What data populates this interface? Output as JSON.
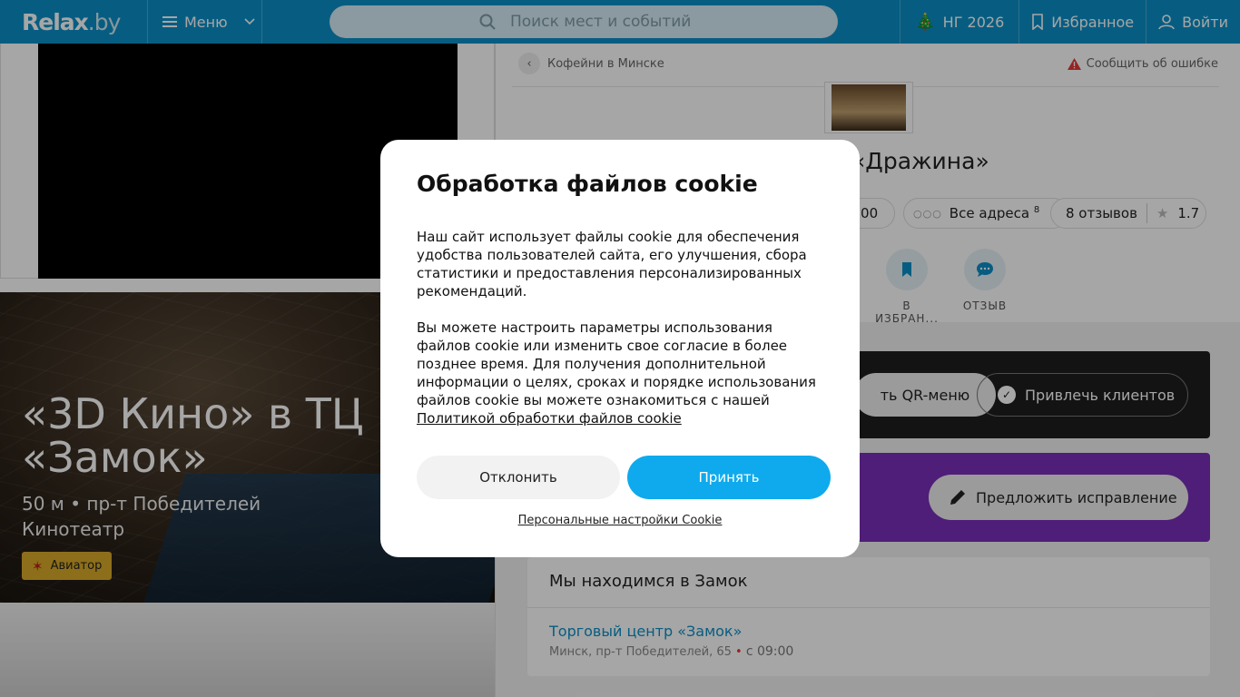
{
  "header": {
    "logo": "Relax",
    "logo_suffix": ".by",
    "menu_label": "Меню",
    "search_placeholder": "Поиск мест и событий",
    "ng_label": "НГ 2026",
    "favorites_label": "Избранное",
    "login_label": "Войти",
    "bg_color": "#0b8fc6"
  },
  "hero": {
    "title": "«3D Кино» в ТЦ «Замок»",
    "subtitle_line1": "50 м • пр-т Победителей",
    "subtitle_line2": "Кинотеатр",
    "tag_label": "Авиатор",
    "tag_color": "#d9a928"
  },
  "place": {
    "breadcrumb": "Кофейни в Минске",
    "report_label": "Сообщить об ошибке",
    "title": "«Дражина»",
    "hours_label": ":00",
    "addresses_label": "Все адреса",
    "addresses_count": "8",
    "reviews_label": "8 отзывов",
    "rating": "1.7",
    "actions": {
      "favorite_label": "В ИЗБРАН...",
      "review_label": "ОТЗЫВ"
    },
    "qr_label": "ть QR-меню",
    "clients_label": "Привлечь клиентов",
    "suggest_label": "Предложить исправление",
    "location_title": "Мы находимся в Замок",
    "location_name": "Торговый центр «Замок»",
    "location_address": "Минск, пр-т Победителей, 65",
    "location_hours": "с 09:00"
  },
  "cookie_modal": {
    "title": "Обработка файлов cookie",
    "paragraph1": "Наш сайт использует файлы cookie для обеспечения удобства пользователей сайта, его улучшения, сбора статистики и предоставления персонализированных рекомендаций.",
    "paragraph2": "Вы можете настроить параметры использования файлов cookie или изменить свое согласие в более позднее время. Для получения дополнительной информации о целях, сроках и порядке использования файлов cookie вы можете ознакомиться с нашей",
    "policy_link": "Политикой обработки файлов cookie",
    "decline_label": "Отклонить",
    "accept_label": "Принять",
    "settings_link": "Персональные настройки Cookie",
    "accept_color": "#0eaaed"
  }
}
